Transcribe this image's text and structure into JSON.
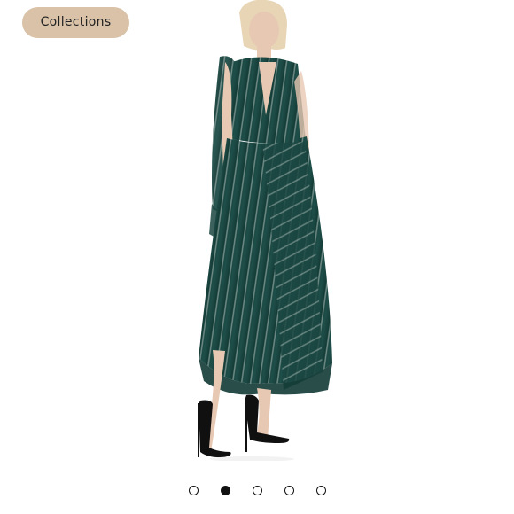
{
  "header": {
    "collections_label": "Collections"
  },
  "product": {
    "image_icon": "dress-photo",
    "colors": {
      "dress": "#1f4f4a",
      "dress_dark": "#123a35",
      "stripe": "#b9c7c3",
      "skin": "#e7c8b3",
      "hair": "#e8d5b6",
      "shoe": "#101010",
      "background": "#ffffff"
    }
  },
  "carousel": {
    "total": 5,
    "active_index": 1,
    "colors": {
      "active": "#111111",
      "inactive_border": "#111111"
    }
  },
  "theme": {
    "button_bg": "#d9c2a8",
    "button_text": "#222222"
  }
}
